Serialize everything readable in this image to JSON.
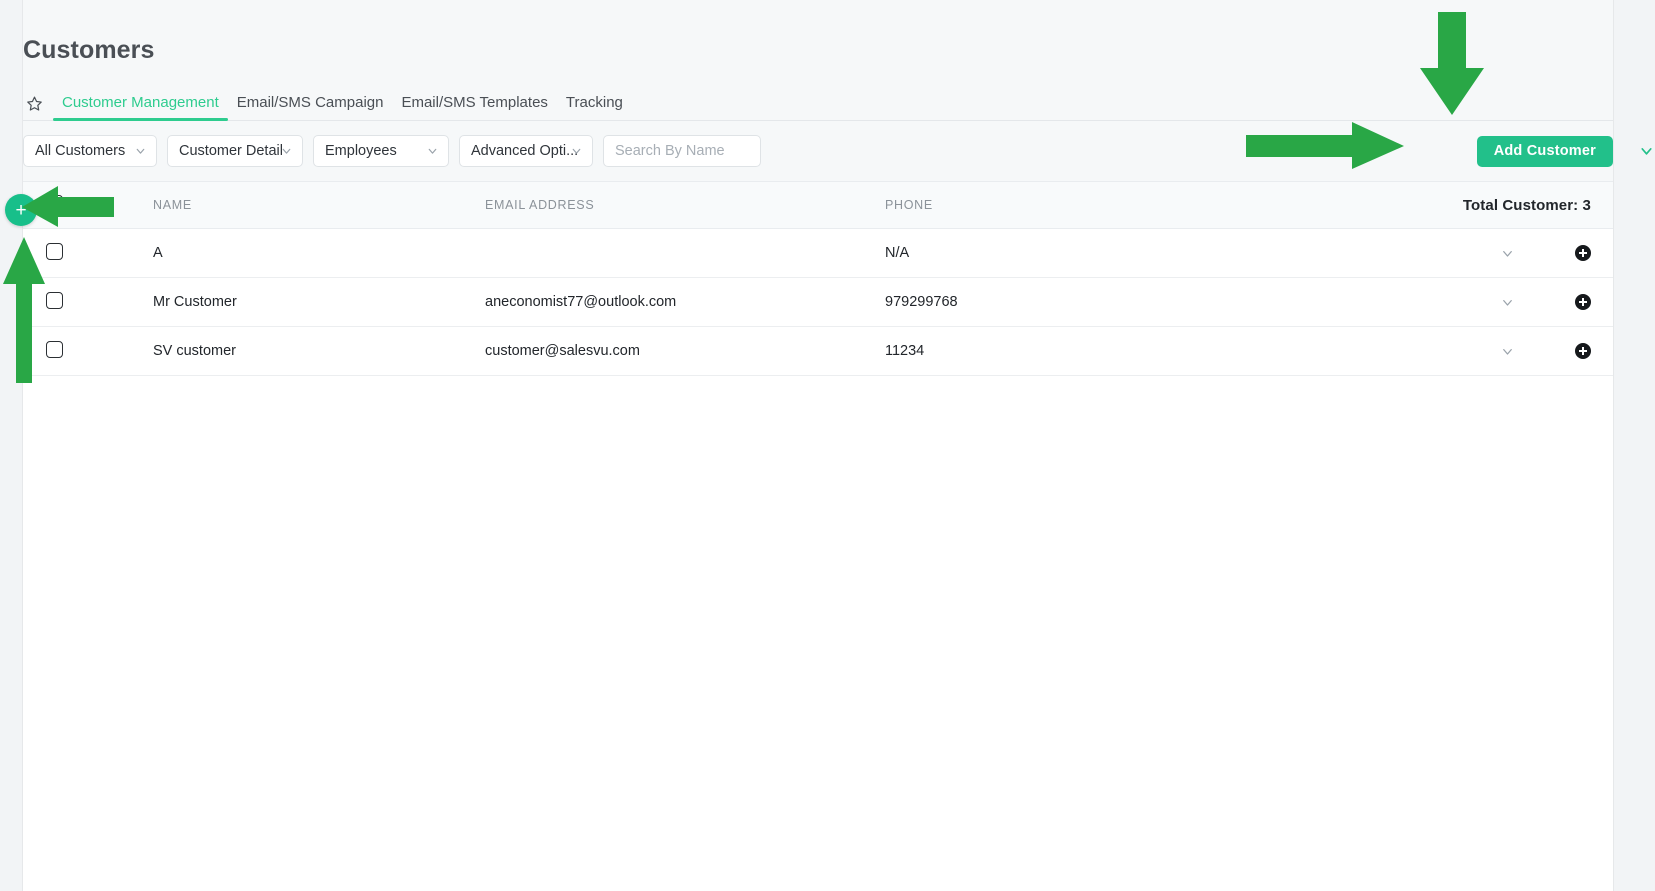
{
  "header": {
    "title": "Customers"
  },
  "tabs": {
    "star_icon": "star-outline-icon",
    "items": [
      {
        "label": "Customer Management",
        "active": true
      },
      {
        "label": "Email/SMS Campaign",
        "active": false
      },
      {
        "label": "Email/SMS Templates",
        "active": false
      },
      {
        "label": "Tracking",
        "active": false
      }
    ]
  },
  "filters": {
    "customer_scope": "All Customers",
    "customer_detail": "Customer Detail",
    "employees": "Employees",
    "advanced_options": "Advanced Opti...",
    "search_placeholder": "Search By Name",
    "search_value": "",
    "add_button_label": "Add Customer",
    "add_dropdown_icon": "chevron-down-icon"
  },
  "table": {
    "columns": [
      "NAME",
      "EMAIL ADDRESS",
      "PHONE"
    ],
    "total_label": "Total Customer: 3",
    "rows": [
      {
        "name": "A",
        "email": "",
        "phone": "N/A"
      },
      {
        "name": "Mr Customer",
        "email": "aneconomist77@outlook.com",
        "phone": "979299768"
      },
      {
        "name": "SV customer",
        "email": "customer@salesvu.com",
        "phone": "11234"
      }
    ]
  },
  "fab": {
    "label": "+"
  },
  "colors": {
    "accent_green": "#22c08a",
    "tab_active": "#2ecc8f",
    "fab_green": "#18bf8a",
    "annotation_green": "#29a746",
    "page_bg": "#f2f4f6",
    "card_bg": "#ffffff"
  }
}
